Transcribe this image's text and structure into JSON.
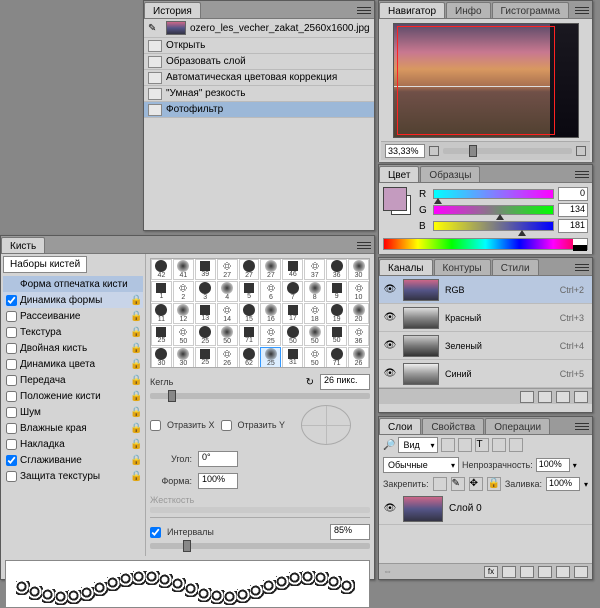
{
  "history": {
    "title": "История",
    "file_name": "ozero_les_vecher_zakat_2560x1600.jpg",
    "items": [
      {
        "label": "Открыть"
      },
      {
        "label": "Образовать слой"
      },
      {
        "label": "Автоматическая цветовая коррекция"
      },
      {
        "label": "\"Умная\" резкость"
      },
      {
        "label": "Фотофильтр",
        "selected": true
      }
    ]
  },
  "navigator": {
    "tabs": [
      "Навигатор",
      "Инфо",
      "Гистограмма"
    ],
    "zoom": "33,33%"
  },
  "color": {
    "tabs": [
      "Цвет",
      "Образцы"
    ],
    "channels": [
      {
        "label": "R",
        "value": "0",
        "slider": "slider-r",
        "thumb_pos": "0%"
      },
      {
        "label": "G",
        "value": "134",
        "slider": "slider-g",
        "thumb_pos": "52%"
      },
      {
        "label": "B",
        "value": "181",
        "slider": "slider-b",
        "thumb_pos": "71%"
      }
    ]
  },
  "channels": {
    "tabs": [
      "Каналы",
      "Контуры",
      "Стили"
    ],
    "items": [
      {
        "name": "RGB",
        "key": "Ctrl+2",
        "thumb": "linear-gradient(#c68,#558,#334)"
      },
      {
        "name": "Красный",
        "key": "Ctrl+3",
        "thumb": "linear-gradient(#ddd,#888,#444)"
      },
      {
        "name": "Зеленый",
        "key": "Ctrl+4",
        "thumb": "linear-gradient(#ccc,#777,#333)"
      },
      {
        "name": "Синий",
        "key": "Ctrl+5",
        "thumb": "linear-gradient(#eee,#999,#555)"
      }
    ]
  },
  "layers": {
    "tabs": [
      "Слои",
      "Свойства",
      "Операции"
    ],
    "kind_label": "Вид",
    "blend_mode": "Обычные",
    "opacity_label": "Непрозрачность:",
    "opacity_value": "100%",
    "lock_label": "Закрепить:",
    "fill_label": "Заливка:",
    "fill_value": "100%",
    "layer_name": "Слой 0"
  },
  "brush": {
    "title": "Кисть",
    "presets_btn": "Наборы кистей",
    "options": [
      {
        "label": "Форма отпечатка кисти",
        "checked": false,
        "sel": true,
        "locked": false,
        "no_checkbox": true
      },
      {
        "label": "Динамика формы",
        "checked": true,
        "highlighted": true,
        "locked": true
      },
      {
        "label": "Рассеивание",
        "checked": false,
        "locked": true
      },
      {
        "label": "Текстура",
        "checked": false,
        "locked": true
      },
      {
        "label": "Двойная кисть",
        "checked": false,
        "locked": true
      },
      {
        "label": "Динамика цвета",
        "checked": false,
        "locked": true
      },
      {
        "label": "Передача",
        "checked": false,
        "locked": true
      },
      {
        "label": "Положение кисти",
        "checked": false,
        "locked": true
      },
      {
        "label": "Шум",
        "checked": false,
        "locked": true
      },
      {
        "label": "Влажные края",
        "checked": false,
        "locked": true
      },
      {
        "label": "Накладка",
        "checked": false,
        "locked": true
      },
      {
        "label": "Сглаживание",
        "checked": true,
        "locked": true
      },
      {
        "label": "Защита текстуры",
        "checked": false,
        "locked": true
      }
    ],
    "size_label": "Кегль",
    "size_value": "26 пикс.",
    "flip_x": "Отразить X",
    "flip_y": "Отразить Y",
    "angle_label": "Угол:",
    "angle_value": "0°",
    "roundness_label": "Форма:",
    "roundness_value": "100%",
    "hardness_label": "Жесткость",
    "spacing_label": "Интервалы",
    "spacing_value": "85%",
    "spacing_checked": true,
    "grid_nums": [
      "42",
      "41",
      "39",
      "27",
      "27",
      "27",
      "46",
      "37",
      "36",
      "30",
      "1",
      "2",
      "3",
      "4",
      "5",
      "6",
      "7",
      "8",
      "9",
      "10",
      "11",
      "12",
      "13",
      "14",
      "15",
      "16",
      "17",
      "18",
      "19",
      "20",
      "25",
      "50",
      "25",
      "50",
      "71",
      "25",
      "50",
      "50",
      "50",
      "36",
      "30",
      "30",
      "25",
      "26",
      "62",
      "25",
      "31",
      "50",
      "71",
      "26"
    ],
    "grid_selected_index": 45
  }
}
